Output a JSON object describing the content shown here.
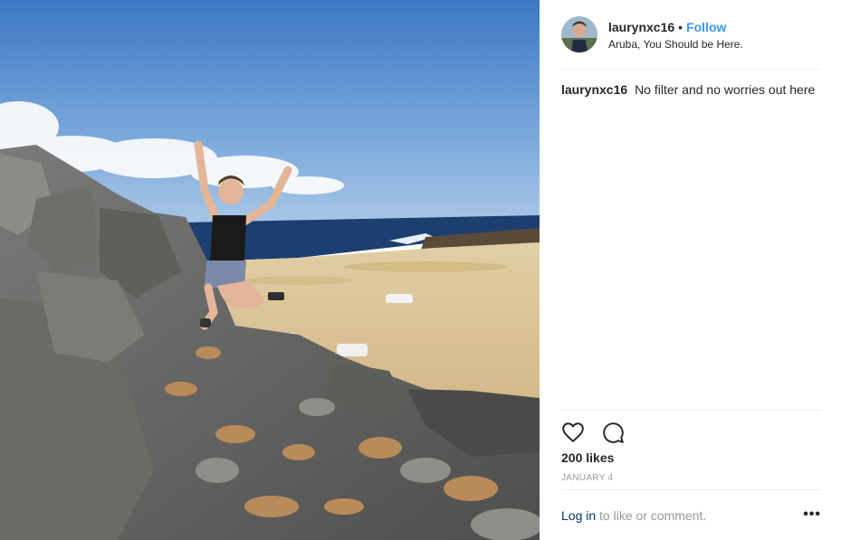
{
  "header": {
    "username": "laurynxc16",
    "separator": "•",
    "follow_label": "Follow",
    "location": "Aruba, You Should be Here."
  },
  "caption": {
    "username": "laurynxc16",
    "text": "No filter and no worries out here"
  },
  "actions": {
    "like_icon": "heart-icon",
    "comment_icon": "comment-icon"
  },
  "likes": "200 likes",
  "date": "JANUARY 4",
  "login": {
    "link_label": "Log in",
    "rest": "to like or comment."
  },
  "more_label": "•••",
  "colors": {
    "follow": "#3897f0",
    "login_link": "#003569",
    "muted": "#999999",
    "sky_top": "#3f7fc8",
    "sea": "#1c3f6e",
    "sand": "#dcc69a"
  }
}
